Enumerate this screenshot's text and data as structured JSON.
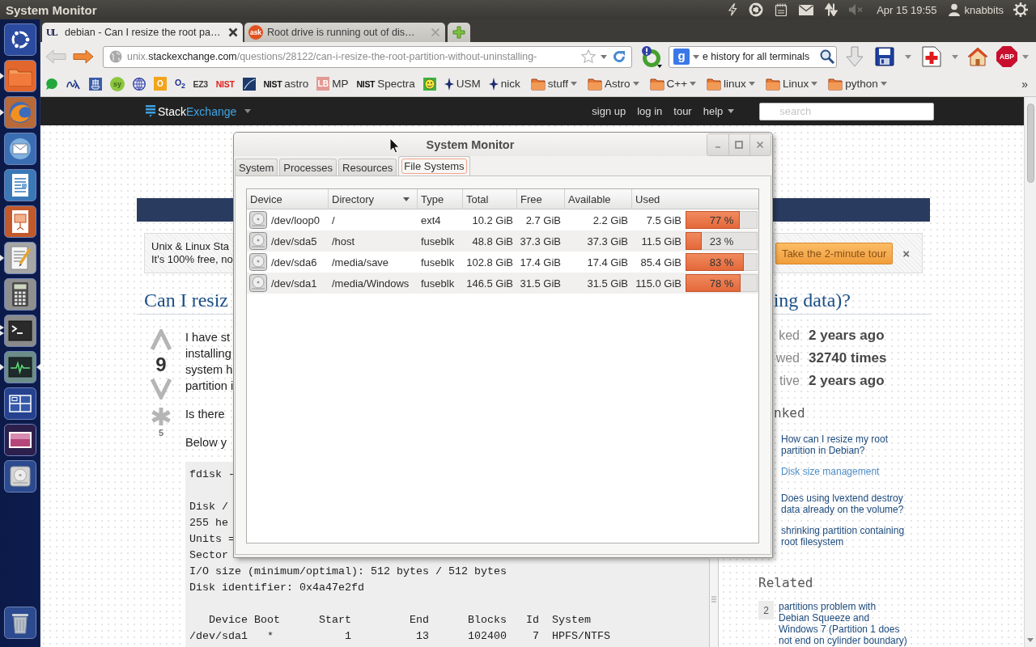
{
  "top_panel": {
    "app_title": "System Monitor",
    "clock": "Apr 15 19:55",
    "user": "knabbits"
  },
  "launcher": [
    {
      "kind": "dash",
      "running": false,
      "multiple": false,
      "focused": false
    },
    {
      "kind": "files",
      "running": true,
      "multiple": false,
      "focused": false
    },
    {
      "kind": "browser",
      "running": true,
      "multiple": false,
      "focused": false
    },
    {
      "kind": "mail",
      "running": false,
      "multiple": false,
      "focused": false
    },
    {
      "kind": "writer",
      "running": false,
      "multiple": false,
      "focused": false
    },
    {
      "kind": "slides",
      "running": false,
      "multiple": false,
      "focused": false
    },
    {
      "kind": "editor",
      "running": true,
      "multiple": false,
      "focused": false
    },
    {
      "kind": "calculator",
      "running": false,
      "multiple": false,
      "focused": false
    },
    {
      "kind": "terminal",
      "running": true,
      "multiple": true,
      "focused": false
    },
    {
      "kind": "monitor",
      "running": true,
      "multiple": false,
      "focused": true
    },
    {
      "kind": "workspaces",
      "running": false,
      "multiple": false,
      "focused": false
    },
    {
      "kind": "photos",
      "running": false,
      "multiple": false,
      "focused": false
    },
    {
      "kind": "disk",
      "running": false,
      "multiple": false,
      "focused": false
    },
    {
      "kind": "trash",
      "running": false,
      "multiple": false,
      "focused": false
    }
  ],
  "browser": {
    "tabs": [
      {
        "kind": "letters",
        "favicon_text": "UL",
        "title": "debian - Can I resize the root pa…",
        "selected": true
      },
      {
        "kind": "disc",
        "favicon_text": "ask",
        "title": "Root drive is running out of dis…",
        "selected": false
      }
    ],
    "back": {
      "disabled": true
    },
    "forward": {
      "disabled": false
    },
    "url": {
      "subdomain": "unix.",
      "domain": "stackexchange.com",
      "path": "/questions/28122/can-i-resize-the-root-partition-without-uninstalling-"
    },
    "search": {
      "engine": "g",
      "value": "e history for all terminals"
    },
    "adblock_label": "ABP",
    "bookmarks": [
      {
        "kind": "bubble"
      },
      {
        "kind": "glyph"
      },
      {
        "kind": "ship"
      },
      {
        "kind": "disc",
        "badge": "sy",
        "color": "#8cc63f"
      },
      {
        "kind": "globe"
      },
      {
        "kind": "tile",
        "badge": "O",
        "color": "#f2a41c"
      },
      {
        "kind": "logotype",
        "badge": "O$_{2}$",
        "color": "#1c2f8c"
      },
      {
        "kind": "logotype",
        "badge": "EZ3",
        "color": "#3c3c3c"
      },
      {
        "kind": "logotype",
        "badge": "NIST",
        "color": "#e0201c"
      },
      {
        "kind": "image"
      },
      {
        "kind": "logotype",
        "badge": "NIST",
        "color": "#111111",
        "label": "astro"
      },
      {
        "kind": "tile",
        "badge": "LB",
        "color": "#e39a94",
        "label": "MP"
      },
      {
        "kind": "logotype",
        "badge": "NIST",
        "color": "#111111",
        "label": "Spectra"
      },
      {
        "kind": "smiley"
      },
      {
        "kind": "star",
        "label": "USM"
      },
      {
        "kind": "star",
        "label": "nick"
      },
      {
        "kind": "folder",
        "label": "stuff"
      },
      {
        "kind": "folder",
        "label": "Astro"
      },
      {
        "kind": "folder",
        "label": "C++"
      },
      {
        "kind": "folder",
        "label": "linux"
      },
      {
        "kind": "folder",
        "label": "Linux"
      },
      {
        "kind": "folder",
        "label": "python"
      }
    ],
    "bookmarks_overflow": "»"
  },
  "page": {
    "topbar": {
      "brand_first": "Stack",
      "brand_second": "Exchange",
      "links": [
        {
          "label": "sign up",
          "menu": false
        },
        {
          "label": "log in",
          "menu": false
        },
        {
          "label": "tour",
          "menu": false
        },
        {
          "label": "help",
          "menu": true
        }
      ],
      "search_placeholder": "search"
    },
    "notice": {
      "lines": [
        "Unix & Linux Sta",
        "It's 100% free, no"
      ],
      "button": "Take the 2-minute tour",
      "close": "×"
    },
    "title_start": "Can I resiz",
    "title_end": "ing data)?",
    "votes": "9",
    "favorites": "5",
    "paragraphs": [
      [
        "I have st",
        "installing",
        "system h",
        "partition i"
      ],
      [
        "Is there"
      ],
      [
        "Below y"
      ]
    ],
    "code": "fdisk -\n\nDisk /\n255 he\nUnits =\nSector\nI/O size (minimum/optimal): 512 bytes / 512 bytes\nDisk identifier: 0x4a47e2fd\n\n   Device Boot      Start         End      Blocks   Id  System\n/dev/sda1   *           1          13      102400    7  HPFS/NTFS",
    "stats": [
      {
        "label": "ked",
        "value": "2 years ago"
      },
      {
        "label": "wed",
        "value": "32740 times"
      },
      {
        "label": "tive",
        "value": "2 years ago"
      }
    ],
    "linked": {
      "heading": "nked",
      "items": [
        {
          "title": "How can I resize my root partition in Debian?",
          "visited": false
        },
        {
          "title": "Disk size management",
          "visited": true
        },
        {
          "title": "Does using lvextend destroy data already on the volume?",
          "visited": false
        },
        {
          "title": "shrinking partition containing root filesystem",
          "visited": false
        }
      ]
    },
    "related": {
      "heading": "Related",
      "items": [
        {
          "votes": "2",
          "title": "partitions problem with Debian Squeeze and Windows 7 (Partition 1 does not end on cylinder boundary)"
        }
      ]
    }
  },
  "system_monitor": {
    "title": "System Monitor",
    "tabs": [
      {
        "label": "System",
        "selected": false
      },
      {
        "label": "Processes",
        "selected": false
      },
      {
        "label": "Resources",
        "selected": false
      },
      {
        "label": "File Systems",
        "selected": true
      }
    ],
    "columns": [
      {
        "label": "Device",
        "sorted": false
      },
      {
        "label": "Directory",
        "sorted": true
      },
      {
        "label": "Type",
        "sorted": false
      },
      {
        "label": "Total",
        "sorted": false
      },
      {
        "label": "Free",
        "sorted": false
      },
      {
        "label": "Available",
        "sorted": false
      },
      {
        "label": "Used",
        "sorted": false
      }
    ],
    "rows": [
      {
        "device": "/dev/loop0",
        "directory": "/",
        "type": "ext4",
        "total": "10.2 GiB",
        "free": "2.7 GiB",
        "available": "2.2 GiB",
        "used": "7.5 GiB",
        "percent": "77 %",
        "level": 0.77
      },
      {
        "device": "/dev/sda5",
        "directory": "/host",
        "type": "fuseblk",
        "total": "48.8 GiB",
        "free": "37.3 GiB",
        "available": "37.3 GiB",
        "used": "11.5 GiB",
        "percent": "23 %",
        "level": 0.23
      },
      {
        "device": "/dev/sda6",
        "directory": "/media/save",
        "type": "fuseblk",
        "total": "102.8 GiB",
        "free": "17.4 GiB",
        "available": "17.4 GiB",
        "used": "85.4 GiB",
        "percent": "83 %",
        "level": 0.83
      },
      {
        "device": "/dev/sda1",
        "directory": "/media/Windows",
        "type": "fuseblk",
        "total": "146.5 GiB",
        "free": "31.5 GiB",
        "available": "31.5 GiB",
        "used": "115.0 GiB",
        "percent": "78 %",
        "level": 0.78
      }
    ]
  }
}
